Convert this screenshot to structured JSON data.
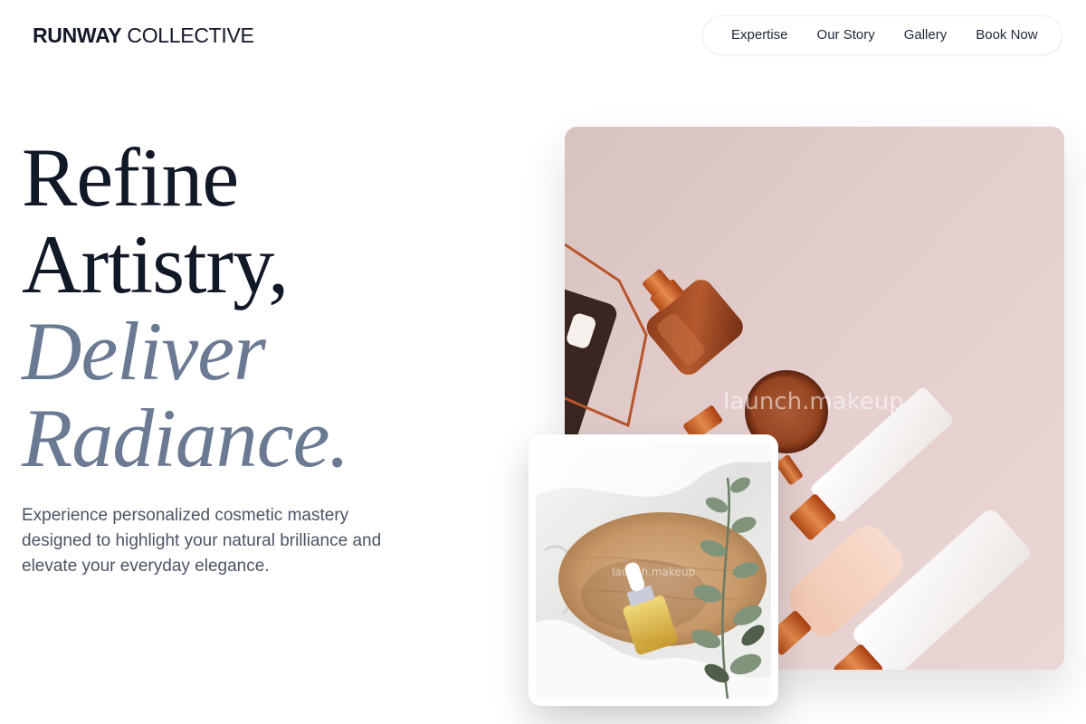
{
  "header": {
    "brand_strong": "RUNWAY",
    "brand_light": " COLLECTIVE",
    "nav": [
      {
        "label": "Expertise"
      },
      {
        "label": "Our Story"
      },
      {
        "label": "Gallery"
      },
      {
        "label": "Book Now"
      }
    ]
  },
  "hero": {
    "line1": "Refine",
    "line2": "Artistry,",
    "line3": "Deliver",
    "line4": "Radiance.",
    "description": "Experience personalized cosmetic mastery designed to highlight your natural brilliance and elevate your everyday elegance."
  },
  "images": {
    "main_watermark": "launch.makeup",
    "inset_watermark": "launch.makeup"
  },
  "colors": {
    "heading_dark": "#111827",
    "heading_accent": "#6b7a93",
    "body_text": "#4b5563",
    "copper": "#c1612b",
    "blush": "#e6d3d2"
  }
}
